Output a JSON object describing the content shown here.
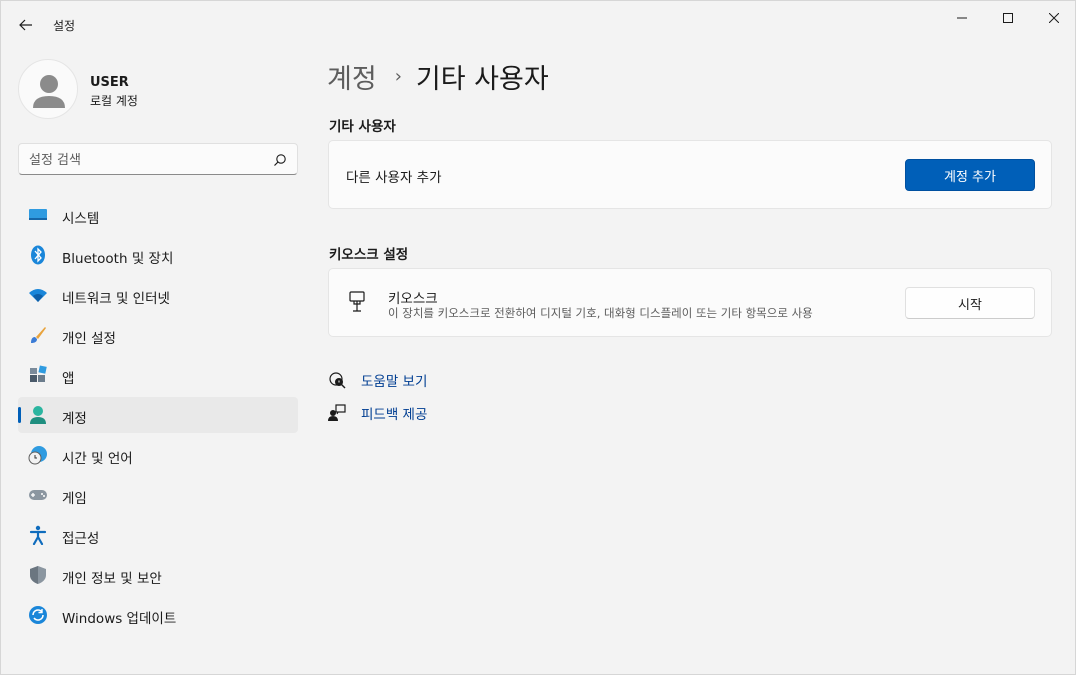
{
  "titlebar": {
    "app_title": "설정"
  },
  "user": {
    "name": "USER",
    "account_type": "로컬 계정"
  },
  "search": {
    "placeholder": "설정 검색",
    "value": ""
  },
  "sidebar": {
    "items": [
      {
        "label": "시스템",
        "icon": "system-monitor-icon",
        "active": false
      },
      {
        "label": "Bluetooth 및 장치",
        "icon": "bluetooth-icon",
        "active": false
      },
      {
        "label": "네트워크 및 인터넷",
        "icon": "wifi-icon",
        "active": false
      },
      {
        "label": "개인 설정",
        "icon": "paintbrush-icon",
        "active": false
      },
      {
        "label": "앱",
        "icon": "apps-icon",
        "active": false
      },
      {
        "label": "계정",
        "icon": "account-icon",
        "active": true
      },
      {
        "label": "시간 및 언어",
        "icon": "globe-clock-icon",
        "active": false
      },
      {
        "label": "게임",
        "icon": "gamepad-icon",
        "active": false
      },
      {
        "label": "접근성",
        "icon": "accessibility-icon",
        "active": false
      },
      {
        "label": "개인 정보 및 보안",
        "icon": "shield-icon",
        "active": false
      },
      {
        "label": "Windows 업데이트",
        "icon": "windows-update-icon",
        "active": false
      }
    ]
  },
  "breadcrumb": {
    "parent": "계정",
    "separator": "›",
    "current": "기타 사용자"
  },
  "other_users": {
    "section_title": "기타 사용자",
    "add_label": "다른 사용자 추가",
    "add_button": "계정 추가"
  },
  "kiosk": {
    "section_title": "키오스크 설정",
    "title": "키오스크",
    "description": "이 장치를 키오스크로 전환하여 디지털 기호, 대화형 디스플레이 또는 기타 항목으로 사용",
    "start_button": "시작"
  },
  "links": {
    "help": "도움말 보기",
    "feedback": "피드백 제공"
  },
  "colors": {
    "accent": "#005fb8",
    "link": "#003e92",
    "background": "#f3f3f3"
  }
}
